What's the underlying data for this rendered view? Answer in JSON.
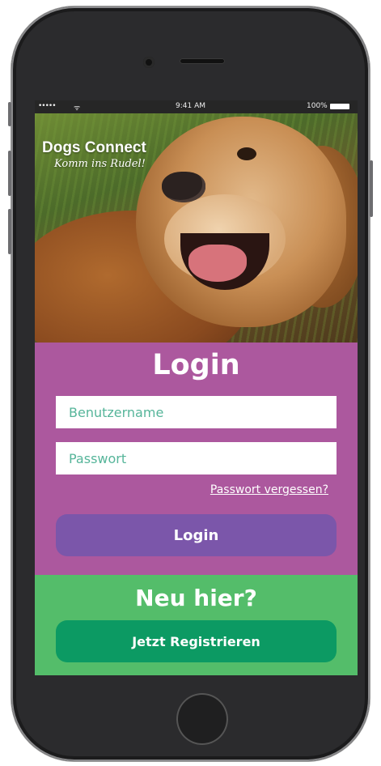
{
  "status_bar": {
    "signal": "•••••",
    "wifi": "ᯤ",
    "time": "9:41 AM",
    "battery_percent": "100%"
  },
  "brand": {
    "title": "Dogs Connect",
    "tagline": "Komm ins Rudel!"
  },
  "login": {
    "heading": "Login",
    "username_placeholder": "Benutzername",
    "password_placeholder": "Passwort",
    "forgot_password": "Passwort vergessen?",
    "button_label": "Login"
  },
  "register": {
    "heading": "Neu hier?",
    "button_label": "Jetzt Registrieren"
  },
  "colors": {
    "login_panel": "#ac589e",
    "login_button": "#7b56aa",
    "register_panel": "#54bd6a",
    "register_button": "#0c9a63",
    "placeholder_text": "#56b59a"
  },
  "icons": [
    "signal-icon",
    "wifi-icon",
    "battery-icon",
    "camera-icon",
    "speaker-icon",
    "home-button-icon"
  ]
}
